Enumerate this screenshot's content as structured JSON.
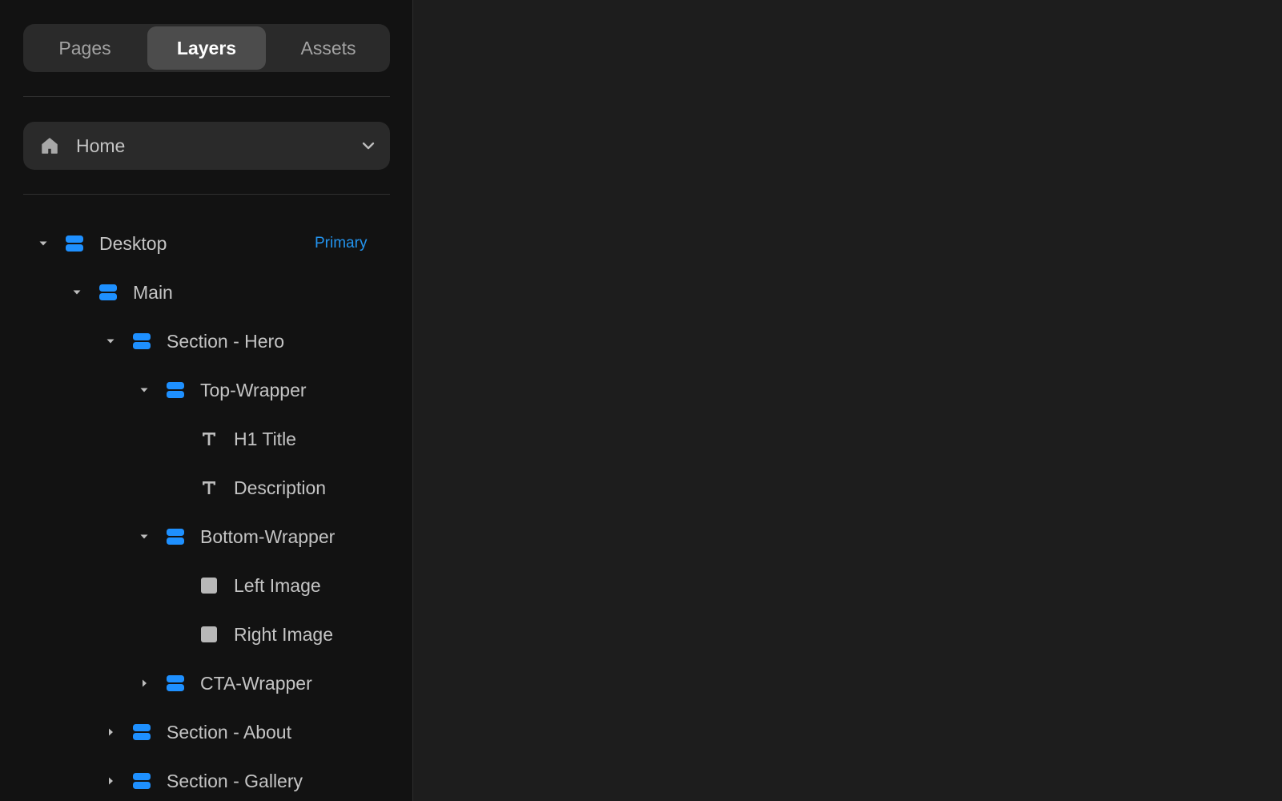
{
  "tabs": [
    "Pages",
    "Layers",
    "Assets"
  ],
  "active_tab": "Layers",
  "page_select": {
    "icon": "home-icon",
    "value": "Home",
    "chevron": "chevron-down-icon"
  },
  "colors": {
    "accent": "#2394ef",
    "frame_icon": "#1e90ff",
    "sidebar_bg": "#121212",
    "canvas_bg": "#1d1d1d"
  },
  "layers": [
    {
      "name": "Desktop",
      "type": "frame",
      "depth": 0,
      "expanded": true,
      "badge": "Primary"
    },
    {
      "name": "Main",
      "type": "frame",
      "depth": 1,
      "expanded": true
    },
    {
      "name": "Section - Hero",
      "type": "frame",
      "depth": 2,
      "expanded": true
    },
    {
      "name": "Top-Wrapper",
      "type": "frame",
      "depth": 3,
      "expanded": true
    },
    {
      "name": "H1 Title",
      "type": "text",
      "depth": 4
    },
    {
      "name": "Description",
      "type": "text",
      "depth": 4
    },
    {
      "name": "Bottom-Wrapper",
      "type": "frame",
      "depth": 3,
      "expanded": true
    },
    {
      "name": "Left Image",
      "type": "image",
      "depth": 4
    },
    {
      "name": "Right Image",
      "type": "image",
      "depth": 4
    },
    {
      "name": "CTA-Wrapper",
      "type": "frame",
      "depth": 3,
      "expanded": false
    },
    {
      "name": "Section - About",
      "type": "frame",
      "depth": 2,
      "expanded": false
    },
    {
      "name": "Section - Gallery",
      "type": "frame",
      "depth": 2,
      "expanded": false
    }
  ]
}
